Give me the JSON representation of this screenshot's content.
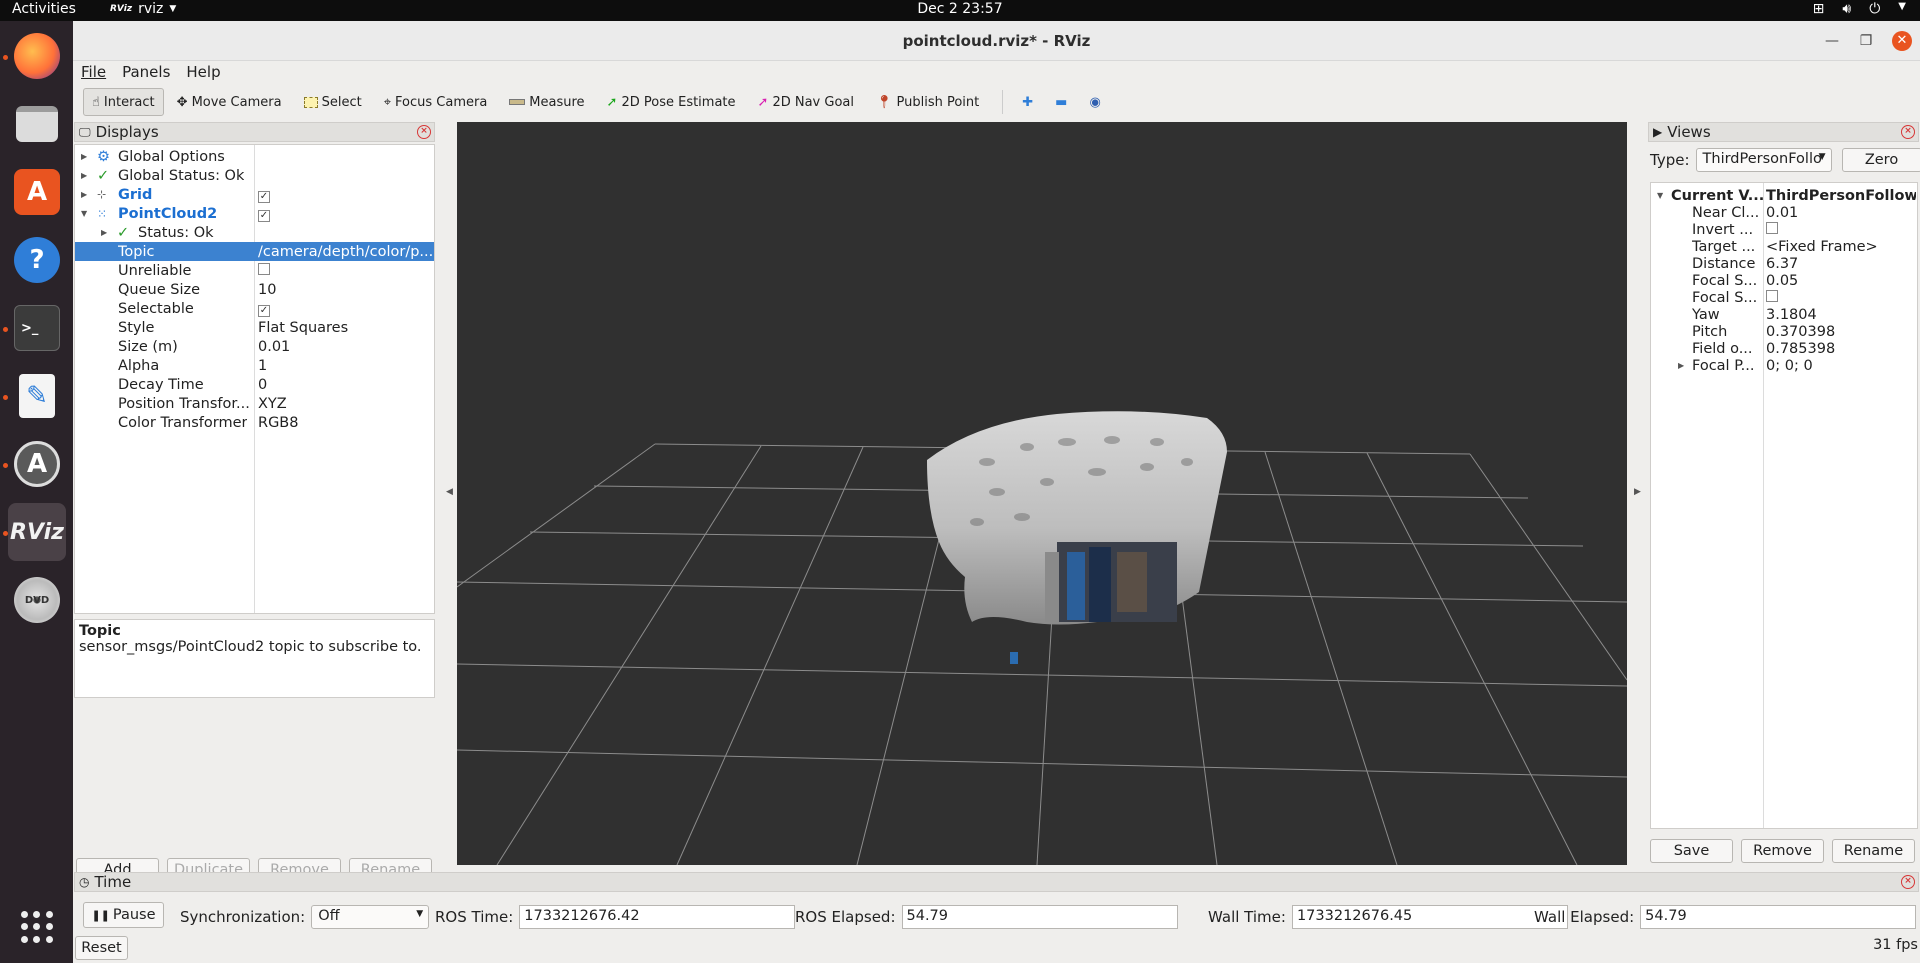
{
  "topbar": {
    "activities": "Activities",
    "app_name": "rviz",
    "clock": "Dec 2  23:57"
  },
  "window": {
    "title": "pointcloud.rviz* - RViz"
  },
  "menu": [
    "File",
    "Panels",
    "Help"
  ],
  "toolbar": {
    "interact": "Interact",
    "move_camera": "Move Camera",
    "select": "Select",
    "focus_camera": "Focus Camera",
    "measure": "Measure",
    "pose_estimate": "2D Pose Estimate",
    "nav_goal": "2D Nav Goal",
    "publish_point": "Publish Point"
  },
  "displays": {
    "title": "Displays",
    "global_options": "Global Options",
    "global_status": "Global Status: Ok",
    "grid": "Grid",
    "pointcloud2": "PointCloud2",
    "status_ok": "Status: Ok",
    "props": [
      {
        "key": "Topic",
        "value": "/camera/depth/color/p..."
      },
      {
        "key": "Unreliable",
        "value": ""
      },
      {
        "key": "Queue Size",
        "value": "10"
      },
      {
        "key": "Selectable",
        "value": ""
      },
      {
        "key": "Style",
        "value": "Flat Squares"
      },
      {
        "key": "Size (m)",
        "value": "0.01"
      },
      {
        "key": "Alpha",
        "value": "1"
      },
      {
        "key": "Decay Time",
        "value": "0"
      },
      {
        "key": "Position Transfor...",
        "value": "XYZ"
      },
      {
        "key": "Color Transformer",
        "value": "RGB8"
      }
    ],
    "desc_title": "Topic",
    "desc_text": "sensor_msgs/PointCloud2 topic to subscribe to.",
    "buttons": {
      "add": "Add",
      "duplicate": "Duplicate",
      "remove": "Remove",
      "rename": "Rename"
    }
  },
  "views": {
    "title": "Views",
    "type_label": "Type:",
    "type_value": "ThirdPersonFollo",
    "zero": "Zero",
    "current_key": "Current V...",
    "current_val": "ThirdPersonFollow...",
    "props": [
      {
        "key": "Near Cl...",
        "value": "0.01"
      },
      {
        "key": "Invert ...",
        "value": ""
      },
      {
        "key": "Target ...",
        "value": "<Fixed Frame>"
      },
      {
        "key": "Distance",
        "value": "6.37"
      },
      {
        "key": "Focal S...",
        "value": "0.05"
      },
      {
        "key": "Focal S...",
        "value": ""
      },
      {
        "key": "Yaw",
        "value": "3.1804"
      },
      {
        "key": "Pitch",
        "value": "0.370398"
      },
      {
        "key": "Field o...",
        "value": "0.785398"
      },
      {
        "key": "Focal P...",
        "value": "0; 0; 0"
      }
    ],
    "buttons": {
      "save": "Save",
      "remove": "Remove",
      "rename": "Rename"
    }
  },
  "time": {
    "title": "Time",
    "pause": "Pause",
    "sync_label": "Synchronization:",
    "sync_value": "Off",
    "ros_time_label": "ROS Time:",
    "ros_time": "1733212676.42",
    "ros_elapsed_label": "ROS Elapsed:",
    "ros_elapsed": "54.79",
    "wall_time_label": "Wall Time:",
    "wall_time": "1733212676.45",
    "wall_elapsed_label": "Wall Elapsed:",
    "wall_elapsed": "54.79",
    "reset": "Reset"
  },
  "fps": "31 fps",
  "colors": {
    "selection": "#3c82d0",
    "display_name": "#1c6fd1",
    "status_ok": "#2b9b2b",
    "viewport_bg": "#303030",
    "ubuntu_orange": "#e95420"
  },
  "dock_icons": [
    "firefox-icon",
    "files-icon",
    "software-center-icon",
    "help-icon",
    "terminal-icon",
    "text-editor-icon",
    "software-updater-icon",
    "rviz-icon",
    "dvd-icon",
    "show-apps-icon"
  ]
}
